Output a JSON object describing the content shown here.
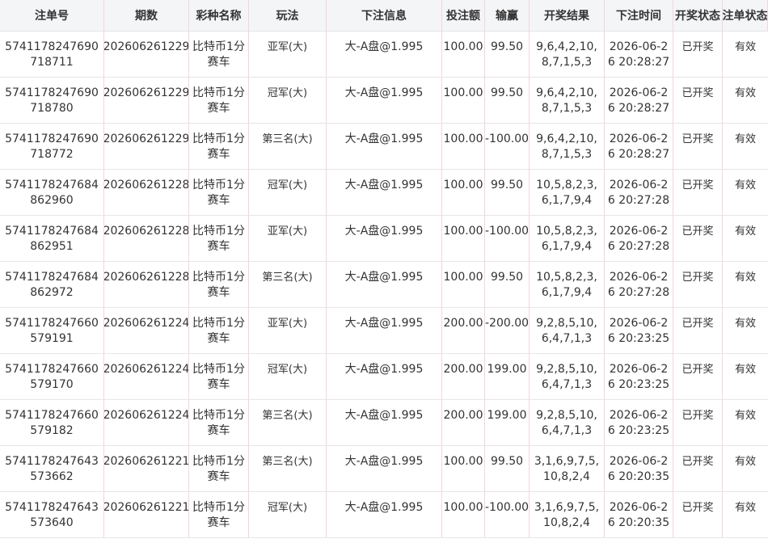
{
  "table": {
    "headers": [
      "注单号",
      "期数",
      "彩种名称",
      "玩法",
      "下注信息",
      "投注额",
      "输赢",
      "开奖结果",
      "下注时间",
      "开奖状态",
      "注单状态"
    ],
    "rows": [
      {
        "order_no": "5741178247690718711",
        "issue": "202606261229",
        "game": "比特币1分赛车",
        "play": "亚军(大)",
        "info": "大-A盘@1.995",
        "amount": "100.00",
        "profit": "99.50",
        "result": "9,6,4,2,10,8,7,1,5,3",
        "time": "2026-06-26 20:28:27",
        "draw_status": "已开奖",
        "order_status": "有效"
      },
      {
        "order_no": "5741178247690718780",
        "issue": "202606261229",
        "game": "比特币1分赛车",
        "play": "冠军(大)",
        "info": "大-A盘@1.995",
        "amount": "100.00",
        "profit": "99.50",
        "result": "9,6,4,2,10,8,7,1,5,3",
        "time": "2026-06-26 20:28:27",
        "draw_status": "已开奖",
        "order_status": "有效"
      },
      {
        "order_no": "5741178247690718772",
        "issue": "202606261229",
        "game": "比特币1分赛车",
        "play": "第三名(大)",
        "info": "大-A盘@1.995",
        "amount": "100.00",
        "profit": "-100.00",
        "result": "9,6,4,2,10,8,7,1,5,3",
        "time": "2026-06-26 20:28:27",
        "draw_status": "已开奖",
        "order_status": "有效"
      },
      {
        "order_no": "5741178247684862960",
        "issue": "202606261228",
        "game": "比特币1分赛车",
        "play": "冠军(大)",
        "info": "大-A盘@1.995",
        "amount": "100.00",
        "profit": "99.50",
        "result": "10,5,8,2,3,6,1,7,9,4",
        "time": "2026-06-26 20:27:28",
        "draw_status": "已开奖",
        "order_status": "有效"
      },
      {
        "order_no": "5741178247684862951",
        "issue": "202606261228",
        "game": "比特币1分赛车",
        "play": "亚军(大)",
        "info": "大-A盘@1.995",
        "amount": "100.00",
        "profit": "-100.00",
        "result": "10,5,8,2,3,6,1,7,9,4",
        "time": "2026-06-26 20:27:28",
        "draw_status": "已开奖",
        "order_status": "有效"
      },
      {
        "order_no": "5741178247684862972",
        "issue": "202606261228",
        "game": "比特币1分赛车",
        "play": "第三名(大)",
        "info": "大-A盘@1.995",
        "amount": "100.00",
        "profit": "99.50",
        "result": "10,5,8,2,3,6,1,7,9,4",
        "time": "2026-06-26 20:27:28",
        "draw_status": "已开奖",
        "order_status": "有效"
      },
      {
        "order_no": "5741178247660579191",
        "issue": "202606261224",
        "game": "比特币1分赛车",
        "play": "亚军(大)",
        "info": "大-A盘@1.995",
        "amount": "200.00",
        "profit": "-200.00",
        "result": "9,2,8,5,10,6,4,7,1,3",
        "time": "2026-06-26 20:23:25",
        "draw_status": "已开奖",
        "order_status": "有效"
      },
      {
        "order_no": "5741178247660579170",
        "issue": "202606261224",
        "game": "比特币1分赛车",
        "play": "冠军(大)",
        "info": "大-A盘@1.995",
        "amount": "200.00",
        "profit": "199.00",
        "result": "9,2,8,5,10,6,4,7,1,3",
        "time": "2026-06-26 20:23:25",
        "draw_status": "已开奖",
        "order_status": "有效"
      },
      {
        "order_no": "5741178247660579182",
        "issue": "202606261224",
        "game": "比特币1分赛车",
        "play": "第三名(大)",
        "info": "大-A盘@1.995",
        "amount": "200.00",
        "profit": "199.00",
        "result": "9,2,8,5,10,6,4,7,1,3",
        "time": "2026-06-26 20:23:25",
        "draw_status": "已开奖",
        "order_status": "有效"
      },
      {
        "order_no": "5741178247643573662",
        "issue": "202606261221",
        "game": "比特币1分赛车",
        "play": "第三名(大)",
        "info": "大-A盘@1.995",
        "amount": "100.00",
        "profit": "99.50",
        "result": "3,1,6,9,7,5,10,8,2,4",
        "time": "2026-06-26 20:20:35",
        "draw_status": "已开奖",
        "order_status": "有效"
      },
      {
        "order_no": "5741178247643573640",
        "issue": "202606261221",
        "game": "比特币1分赛车",
        "play": "冠军(大)",
        "info": "大-A盘@1.995",
        "amount": "100.00",
        "profit": "-100.00",
        "result": "3,1,6,9,7,5,10,8,2,4",
        "time": "2026-06-26 20:20:35",
        "draw_status": "已开奖",
        "order_status": "有效"
      }
    ]
  }
}
